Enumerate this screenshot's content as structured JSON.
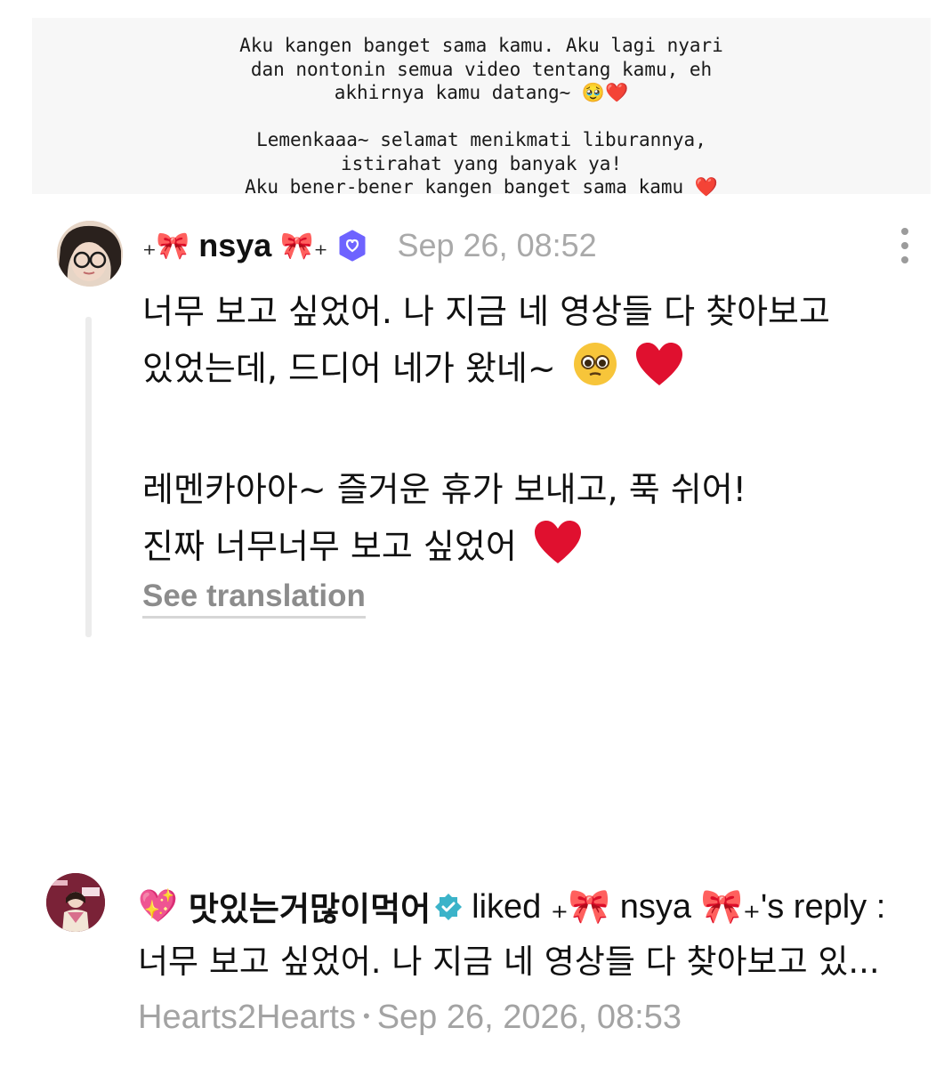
{
  "note": {
    "text": "Aku kangen banget sama kamu. Aku lagi nyari\ndan nontonin semua video tentang kamu, eh\nakhirnya kamu datang~ 🥹❤️\n\nLemenkaaa~ selamat menikmati liburannya,\nistirahat yang banyak ya!\nAku bener-bener kangen banget sama kamu ❤️"
  },
  "post": {
    "user_prefix": "₊🎀",
    "username": "nsya",
    "user_suffix": "🎀₊",
    "timestamp": "Sep 26, 08:52",
    "line1": "너무 보고 싶었어. 나 지금 네 영상들 다 찾아보고",
    "line2": "있었는데, 드디어 네가 왔네~",
    "line3": "레멘카아아~ 즐거운 휴가 보내고, 푹 쉬어!",
    "line4": "진짜 너무너무 보고 싶었어",
    "see_translation": "See translation"
  },
  "notification": {
    "emoji": "💖",
    "username": "맛있는거많이먹어",
    "action": "liked ₊🎀 nsya 🎀₊'s reply :",
    "preview": "너무 보고 싶었어. 나 지금 네 영상들 다 찾아보고 있...",
    "group": "Hearts2Hearts",
    "time": "Sep 26, 2026, 08:53"
  },
  "colors": {
    "muted": "#a9a9a9",
    "verified_purple": "#6e63ff",
    "verified_teal": "#3bb3c9",
    "heart": "#e0102f"
  }
}
